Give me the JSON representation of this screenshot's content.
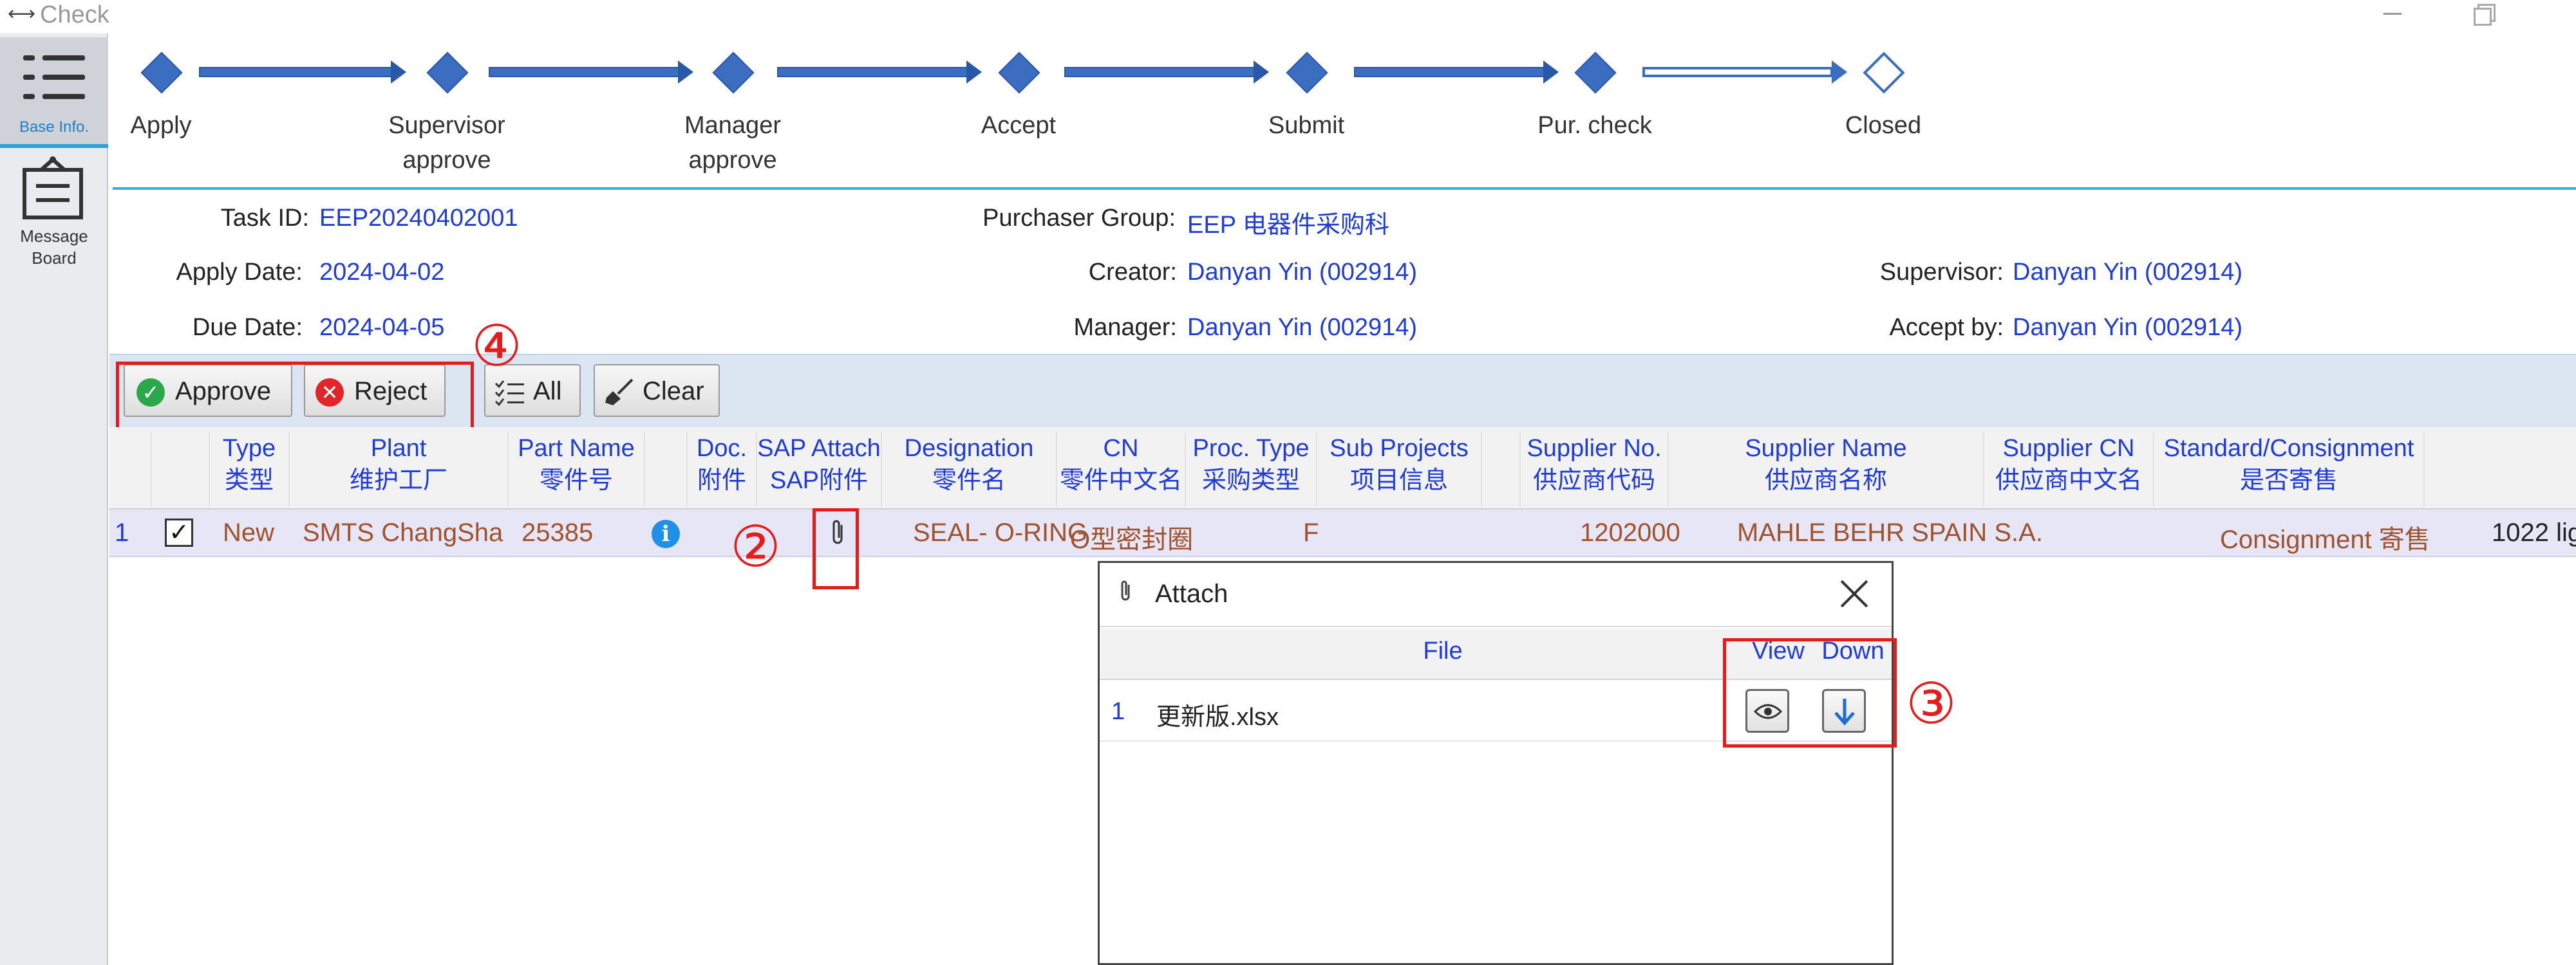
{
  "window": {
    "title": "Check"
  },
  "nav": {
    "base_info": "Base Info.",
    "message_board_line1": "Message",
    "message_board_line2": "Board"
  },
  "workflow": {
    "steps": [
      {
        "line1": "Apply",
        "line2": ""
      },
      {
        "line1": "Supervisor",
        "line2": "approve"
      },
      {
        "line1": "Manager",
        "line2": "approve"
      },
      {
        "line1": "Accept",
        "line2": ""
      },
      {
        "line1": "Submit",
        "line2": ""
      },
      {
        "line1": "Pur. check",
        "line2": ""
      },
      {
        "line1": "Closed",
        "line2": ""
      }
    ],
    "completed_count": 6
  },
  "info": {
    "task_id_label": "Task ID:",
    "task_id": "EEP20240402001",
    "purchaser_group_label": "Purchaser Group:",
    "purchaser_group": "EEP 电器件采购科",
    "apply_date_label": "Apply Date:",
    "apply_date": "2024-04-02",
    "creator_label": "Creator:",
    "creator": "Danyan Yin (002914)",
    "supervisor_label": "Supervisor:",
    "supervisor": "Danyan Yin (002914)",
    "due_date_label": "Due Date:",
    "due_date": "2024-04-05",
    "manager_label": "Manager:",
    "manager": "Danyan Yin (002914)",
    "accept_by_label": "Accept by:",
    "accept_by": "Danyan Yin (002914)"
  },
  "toolbar": {
    "approve": "Approve",
    "reject": "Reject",
    "all": "All",
    "clear": "Clear"
  },
  "annotations": {
    "a2": "②",
    "a3": "③",
    "a4": "④"
  },
  "grid": {
    "columns": [
      {
        "en": "Type",
        "cn": "类型"
      },
      {
        "en": "Plant",
        "cn": "维护工厂"
      },
      {
        "en": "Part Name",
        "cn": "零件号"
      },
      {
        "en": "",
        "cn": ""
      },
      {
        "en": "Doc.",
        "cn": "附件"
      },
      {
        "en": "SAP Attach",
        "cn": "SAP附件"
      },
      {
        "en": "Designation",
        "cn": "零件名"
      },
      {
        "en": "CN",
        "cn": "零件中文名"
      },
      {
        "en": "Proc. Type",
        "cn": "采购类型"
      },
      {
        "en": "Sub Projects",
        "cn": "项目信息"
      },
      {
        "en": "Supplier No.",
        "cn": "供应商代码"
      },
      {
        "en": "Supplier Name",
        "cn": "供应商名称"
      },
      {
        "en": "Supplier CN",
        "cn": "供应商中文名"
      },
      {
        "en": "Standard/Consignment",
        "cn": "是否寄售"
      }
    ],
    "row": {
      "num": "1",
      "checked": true,
      "type": "New",
      "plant": "SMTS ChangSha",
      "part_name": "25385",
      "designation": "SEAL- O-RING",
      "cn": "O型密封圈",
      "proc_type": "F",
      "supplier_no": "1202000",
      "supplier_name": "MAHLE BEHR SPAIN S.A.",
      "consignment": "Consignment 寄售",
      "extra": "1022 lig"
    }
  },
  "attach_dialog": {
    "title": "Attach",
    "col_file": "File",
    "col_view": "View",
    "col_down": "Down",
    "rows": [
      {
        "num": "1",
        "file": "更新版.xlsx"
      }
    ]
  },
  "icons": {
    "approve": "check-circle-icon",
    "reject": "x-circle-icon",
    "all": "checklist-icon",
    "clear": "broom-icon",
    "doc_info": "info-icon",
    "sap_attach": "paperclip-icon",
    "view": "eye-icon",
    "download": "arrow-down-icon"
  },
  "colors": {
    "accent_blue": "#3b6dc0",
    "link_blue": "#1f3bd8",
    "row_text": "#a0522d",
    "annotation_red": "#e51c1c",
    "approve_green": "#2aa84a",
    "reject_red": "#e0262a",
    "toolbar_bg": "#dbe6f2"
  }
}
